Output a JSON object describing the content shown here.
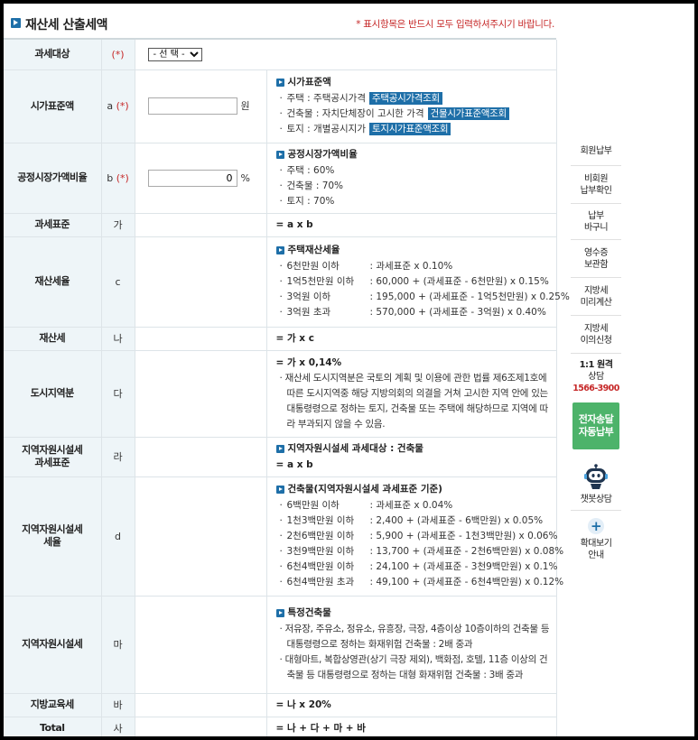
{
  "header": {
    "title": "재산세 산출세액",
    "note": "* 표시항목은 반드시 모두 입력하셔주시기 바랍니다."
  },
  "rows": {
    "target": {
      "label": "과세대상",
      "sym": "(*)",
      "select_value": "- 선 택 -"
    },
    "market": {
      "label": "시가표준액",
      "sym": "a",
      "req": "(*)",
      "input_value": "",
      "unit": "원",
      "title": "시가표준액",
      "items": [
        {
          "name": "주택 : 주택공시가격",
          "link": "주택공시가격조회"
        },
        {
          "name": "건축물 : 자치단체장이 고시한 가격",
          "link": "건물시가표준액조회"
        },
        {
          "name": "토지 : 개별공시지가",
          "link": "토지시가표준액조회"
        }
      ]
    },
    "ratio": {
      "label": "공정시장가액비율",
      "sym": "b",
      "req": "(*)",
      "input_value": "0",
      "unit": "%",
      "title": "공정시장가액비율",
      "items": [
        "주택 : 60%",
        "건축물 : 70%",
        "토지 : 70%"
      ]
    },
    "base": {
      "label": "과세표준",
      "sym": "가",
      "formula": "= a x b"
    },
    "rate": {
      "label": "재산세율",
      "sym": "c",
      "title": "주택재산세율",
      "items": [
        {
          "k": "6천만원 이하",
          "v": ": 과세표준 x 0.10%"
        },
        {
          "k": "1억5천만원 이하",
          "v": ": 60,000 + (과세표준 - 6천만원) x 0.15%"
        },
        {
          "k": "3억원 이하",
          "v": ": 195,000 + (과세표준 - 1억5천만원) x 0.25%"
        },
        {
          "k": "3억원 초과",
          "v": ": 570,000 + (과세표준 - 3억원) x 0.40%"
        }
      ]
    },
    "tax": {
      "label": "재산세",
      "sym": "나",
      "formula": "= 가 x c"
    },
    "city": {
      "label": "도시지역분",
      "sym": "다",
      "formula": "= 가 x 0,14%",
      "para": "재산세 도시지역분은 국토의 계획 및 이용에 관한 법률 제6조제1호에 따른 도시지역중 해당 지방의회의 의결을 거쳐 고시한 지역 안에 있는 대통령령으로 정하는 토지, 건축물 또는 주택에 해당하므로 지역에 따라 부과되지 않을 수 있음."
    },
    "regbase": {
      "label1": "지역자원시설세",
      "label2": "과세표준",
      "sym": "라",
      "title": "지역자원시설세 과세대상 : 건축물",
      "formula": "= a x b"
    },
    "regrate": {
      "label1": "지역자원시설세",
      "label2": "세율",
      "sym": "d",
      "title": "건축물(지역자원시설세 과세표준 기준)",
      "items": [
        {
          "k": "6백만원 이하",
          "v": ": 과세표준 x 0.04%"
        },
        {
          "k": "1천3백만원 이하",
          "v": ": 2,400 + (과세표준 - 6백만원) x 0.05%"
        },
        {
          "k": "2천6백만원 이하",
          "v": ": 5,900 + (과세표준 - 1천3백만원) x 0.06%"
        },
        {
          "k": "3천9백만원 이하",
          "v": ": 13,700 + (과세표준 - 2천6백만원) x 0.08%"
        },
        {
          "k": "6천4백만원 이하",
          "v": ": 24,100 + (과세표준 - 3천9백만원) x 0.1%"
        },
        {
          "k": "6천4백만원 초과",
          "v": ": 49,100 + (과세표준 - 6천4백만원) x 0.12%"
        }
      ]
    },
    "regtax": {
      "label": "지역자원시설세",
      "sym": "마",
      "title": "특정건축물",
      "paras": [
        "저유장, 주유소, 정유소, 유흥장, 극장, 4층이상 10층이하의 건축물 등 대통령령으로 정하는 화재위험 건축물 : 2배 중과",
        "대형마트, 복합상영관(상기 극장 제외), 백화점, 호텔, 11층 이상의 건축물 등 대통령령으로 정하는 대형 화재위험 건축물 : 3배 중과"
      ]
    },
    "edu": {
      "label": "지방교육세",
      "sym": "바",
      "formula": "= 나 x 20%"
    },
    "total": {
      "label": "Total",
      "sym": "사",
      "formula": "= 나 + 다 + 마 + 바"
    }
  },
  "quickmenu": {
    "member_pay": "회원납부",
    "nonmember_line1": "비회원",
    "nonmember_line2": "납부확인",
    "basket_line1": "납부",
    "basket_line2": "바구니",
    "receipt_line1": "영수증",
    "receipt_line2": "보관함",
    "precalc_line1": "지방세",
    "precalc_line2": "미리계산",
    "objection_line1": "지방세",
    "objection_line2": "이의신청",
    "remote_line1": "1:1 원격",
    "remote_line2": "상담",
    "phone": "1566-3900",
    "auto_line1": "전자송달",
    "auto_line2": "자동납부",
    "chatbot": "챗봇상담",
    "zoom_line1": "확대보기",
    "zoom_line2": "안내",
    "accent": "#1e6fa8",
    "green": "#4db36a",
    "red": "#c62828"
  }
}
